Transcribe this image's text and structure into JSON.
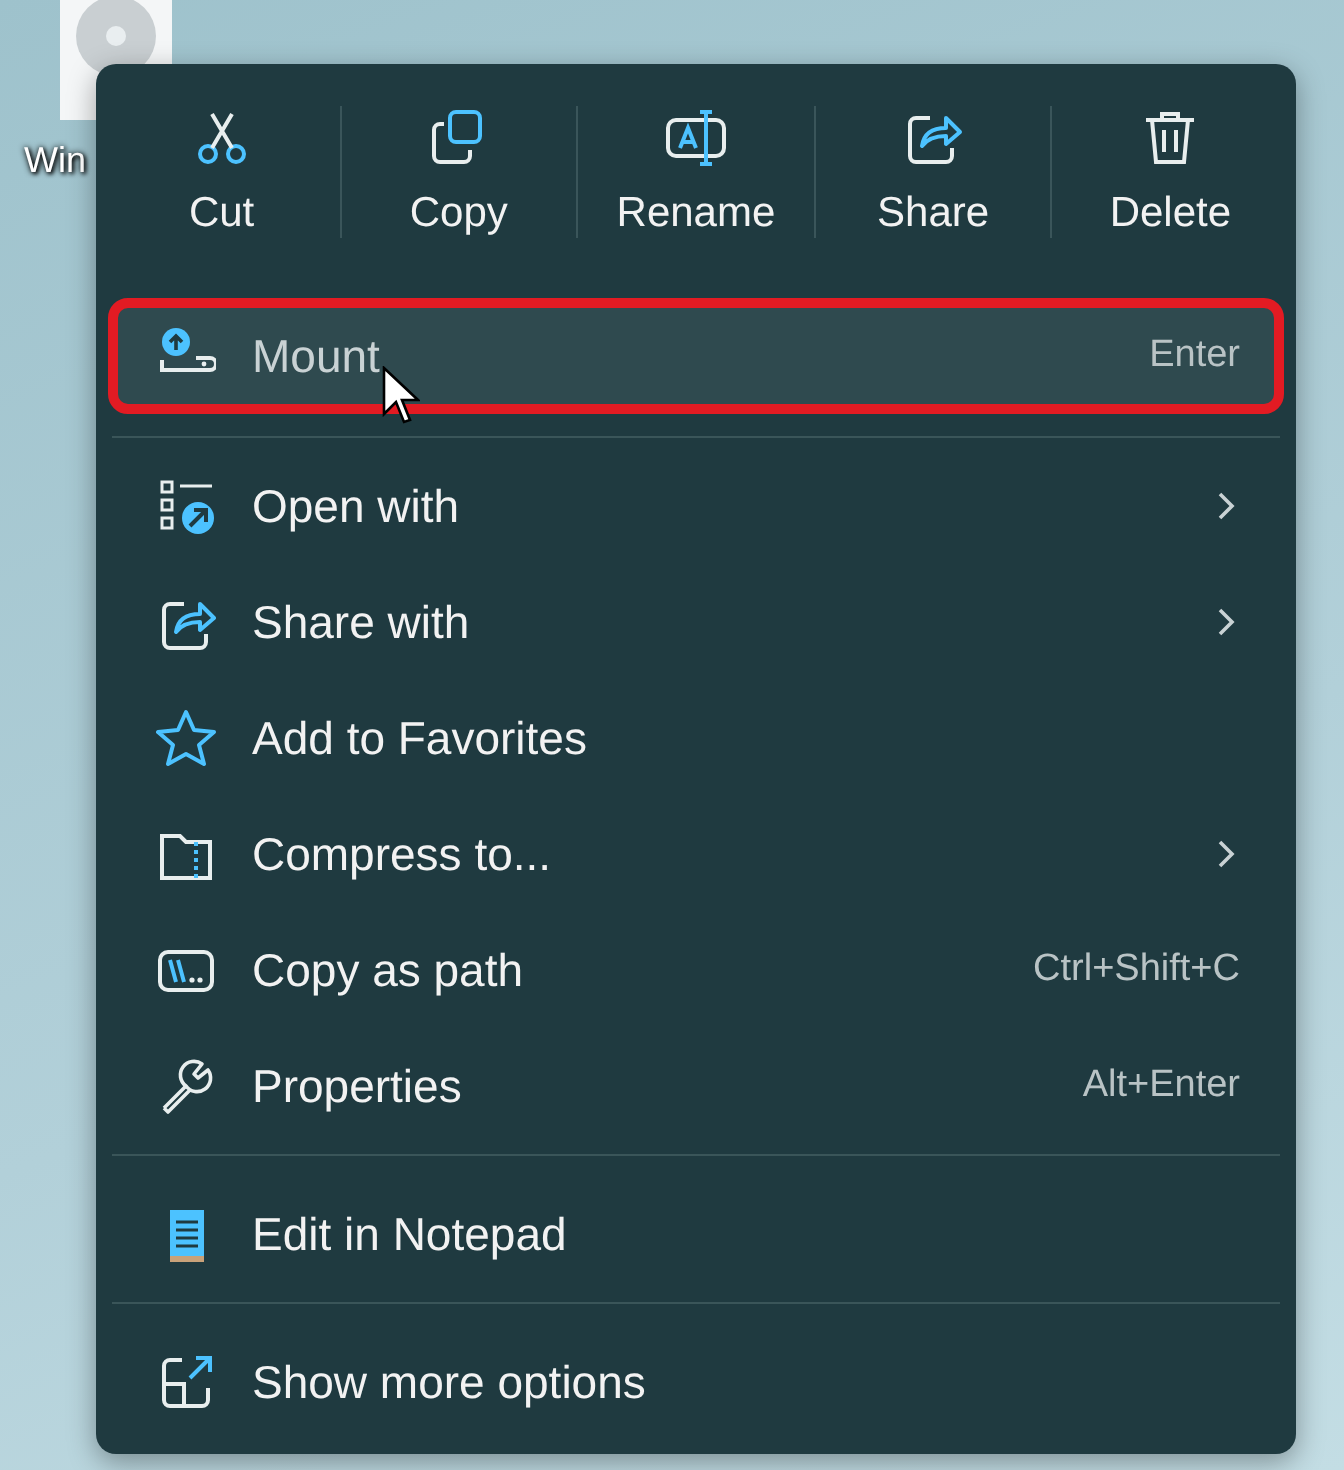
{
  "desktop_icon": {
    "label": "Win"
  },
  "toolbar": [
    {
      "label": "Cut"
    },
    {
      "label": "Copy"
    },
    {
      "label": "Rename"
    },
    {
      "label": "Share"
    },
    {
      "label": "Delete"
    }
  ],
  "groups": [
    {
      "items": [
        {
          "label": "Mount",
          "shortcut": "Enter",
          "hovered": true,
          "annotated": true,
          "submenu": false
        }
      ]
    },
    {
      "items": [
        {
          "label": "Open with",
          "hovered": false,
          "annotated": false,
          "submenu": true
        },
        {
          "label": "Share with",
          "hovered": false,
          "annotated": false,
          "submenu": true
        },
        {
          "label": "Add to Favorites",
          "hovered": false,
          "annotated": false,
          "submenu": false
        },
        {
          "label": "Compress to...",
          "hovered": false,
          "annotated": false,
          "submenu": true
        },
        {
          "label": "Copy as path",
          "shortcut": "Ctrl+Shift+C",
          "hovered": false,
          "annotated": false,
          "submenu": false
        },
        {
          "label": "Properties",
          "shortcut": "Alt+Enter",
          "hovered": false,
          "annotated": false,
          "submenu": false
        }
      ]
    },
    {
      "items": [
        {
          "label": "Edit in Notepad",
          "hovered": false,
          "annotated": false,
          "submenu": false
        }
      ]
    },
    {
      "items": [
        {
          "label": "Show more options",
          "hovered": false,
          "annotated": false,
          "submenu": false
        }
      ]
    }
  ]
}
